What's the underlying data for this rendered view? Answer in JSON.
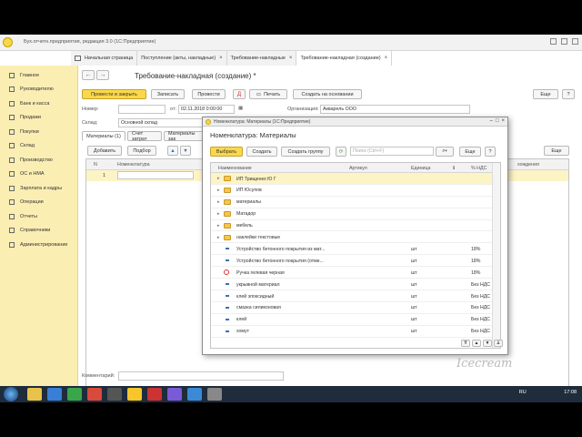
{
  "window": {
    "title": "Бух.отчетн.предприятия, редакция 3.0  (1С:Предприятие)"
  },
  "tabs": [
    {
      "label": "Начальная страница"
    },
    {
      "label": "Поступление (акты, накладные)"
    },
    {
      "label": "Требование-накладные"
    },
    {
      "label": "Требование-накладная (создание)"
    }
  ],
  "sidebar": {
    "items": [
      {
        "label": "Главное",
        "icon": "menu-icon"
      },
      {
        "label": "Руководителю",
        "icon": "chart-icon"
      },
      {
        "label": "Банк и касса",
        "icon": "bank-icon"
      },
      {
        "label": "Продажи",
        "icon": "cart-icon"
      },
      {
        "label": "Покупки",
        "icon": "basket-icon"
      },
      {
        "label": "Склад",
        "icon": "warehouse-icon"
      },
      {
        "label": "Производство",
        "icon": "factory-icon"
      },
      {
        "label": "ОС и НМА",
        "icon": "assets-icon"
      },
      {
        "label": "Зарплата и кадры",
        "icon": "people-icon"
      },
      {
        "label": "Операции",
        "icon": "operations-icon"
      },
      {
        "label": "Отчеты",
        "icon": "report-icon"
      },
      {
        "label": "Справочники",
        "icon": "book-icon"
      },
      {
        "label": "Администрирование",
        "icon": "gear-icon"
      }
    ]
  },
  "doc": {
    "title": "Требование-накладная (создание) *",
    "btn_post_close": "Провести и закрыть",
    "btn_save": "Записать",
    "btn_post": "Провести",
    "btn_print": "Печать",
    "btn_create_based": "Создать на основании",
    "btn_more": "Еще",
    "btn_help": "?",
    "lbl_number": "Номер:",
    "lbl_from": "от:",
    "date_value": "02.11.2018  0:00:00",
    "lbl_org": "Организация:",
    "org_value": "Акварель ООО",
    "lbl_warehouse": "Склад:",
    "warehouse_value": "Основной склад",
    "tab_materials": "Материалы (1)",
    "tab_cost_account": "Счет затрат",
    "tab_customer_materials": "Материалы зак",
    "btn_add": "Добавить",
    "btn_pick": "Подбор",
    "col_n": "N",
    "col_item": "Номенклатура",
    "col_lot": "хождения",
    "row_number": "1",
    "comment_label": "Комментарий:",
    "right_more": "Еще"
  },
  "dialog": {
    "window_title": "Номенклатура: Материалы (1С:Предприятие)",
    "heading": "Номенклатура: Материалы",
    "btn_select": "Выбрать",
    "btn_create": "Создать",
    "btn_create_group": "Создать группу",
    "search_placeholder": "Поиск (Ctrl+F)",
    "btn_more": "Еще",
    "btn_help": "?",
    "columns": {
      "name": "Наименование",
      "article": "Артикул",
      "unit": "Единица",
      "vat": "% НДС"
    },
    "rows": [
      {
        "type": "folder",
        "name": "ИП Трищенко Ю Г",
        "unit": "",
        "vat": ""
      },
      {
        "type": "folder",
        "name": "ИП Юсупов",
        "unit": "",
        "vat": ""
      },
      {
        "type": "folder",
        "name": "материалы",
        "unit": "",
        "vat": ""
      },
      {
        "type": "folder",
        "name": "Матадор",
        "unit": "",
        "vat": ""
      },
      {
        "type": "folder",
        "name": "мебель",
        "unit": "",
        "vat": ""
      },
      {
        "type": "folder",
        "name": "наклейки текстовые",
        "unit": "",
        "vat": ""
      },
      {
        "type": "item",
        "name": "Устройство бетонного покрытия из мат...",
        "unit": "шт",
        "vat": "18%"
      },
      {
        "type": "item",
        "name": "Устройство бетонного покрытия (отме...",
        "unit": "шт",
        "vat": "18%"
      },
      {
        "type": "marked",
        "name": "Ручка гелевая черная",
        "unit": "шт",
        "vat": "18%"
      },
      {
        "type": "item",
        "name": "укрывной материал",
        "unit": "шт",
        "vat": "Без НДС"
      },
      {
        "type": "item",
        "name": "клей эпоксидный",
        "unit": "шт",
        "vat": "Без НДС"
      },
      {
        "type": "item",
        "name": "смазка силиконовая",
        "unit": "шт",
        "vat": "Без НДС"
      },
      {
        "type": "item",
        "name": "клей",
        "unit": "шт",
        "vat": "Без НДС"
      },
      {
        "type": "item",
        "name": "хомут",
        "unit": "шт",
        "vat": "Без НДС"
      }
    ]
  },
  "taskbar": {
    "lang": "RU",
    "time": "17:08"
  },
  "watermark": "Icecream"
}
